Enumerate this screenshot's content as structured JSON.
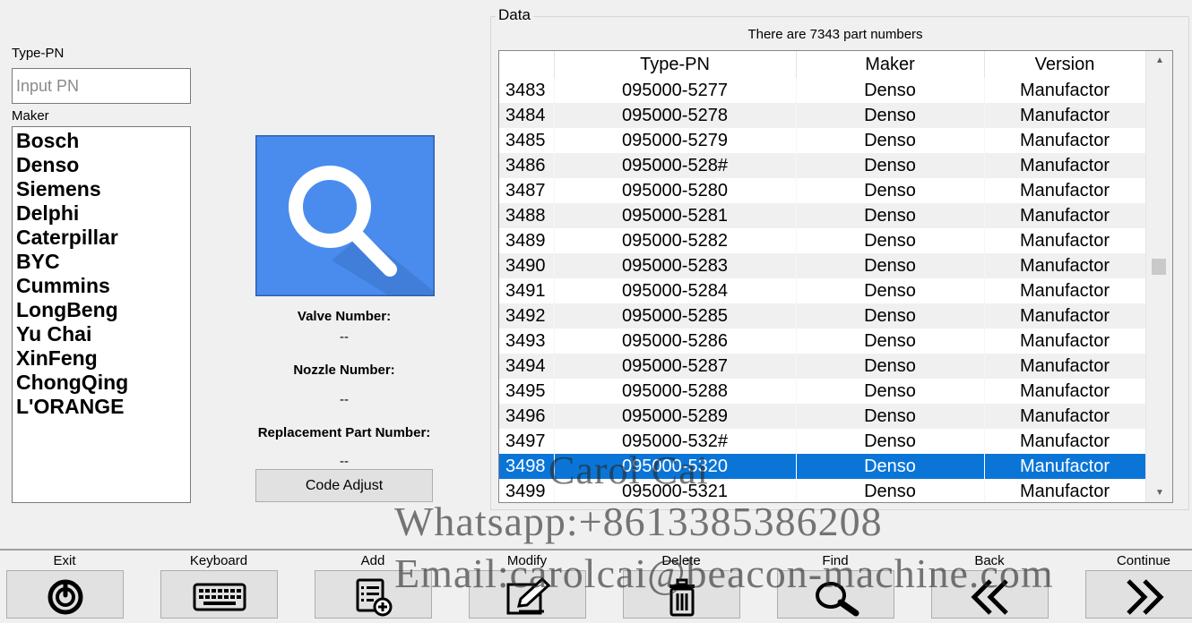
{
  "left": {
    "type_pn_label": "Type-PN",
    "input_placeholder": "Input PN",
    "maker_label": "Maker",
    "makers": [
      "Bosch",
      "Denso",
      "Siemens",
      "Delphi",
      "Caterpillar",
      "BYC",
      "Cummins",
      "LongBeng",
      "Yu Chai",
      "XinFeng",
      "ChongQing",
      "L'ORANGE"
    ]
  },
  "middle": {
    "search_icon": "magnifier-icon",
    "valve_label": "Valve Number:",
    "valve_value": "--",
    "nozzle_label": "Nozzle Number:",
    "nozzle_value": "--",
    "replacement_label": "Replacement Part Number:",
    "replacement_value": "--",
    "code_adjust_label": "Code Adjust"
  },
  "data_panel": {
    "title": "Data",
    "count_text": "There are 7343 part numbers",
    "columns": [
      "",
      "Type-PN",
      "Maker",
      "Version"
    ],
    "selected_row": "3498",
    "rows": [
      [
        "3483",
        "095000-5277",
        "Denso",
        "Manufactor"
      ],
      [
        "3484",
        "095000-5278",
        "Denso",
        "Manufactor"
      ],
      [
        "3485",
        "095000-5279",
        "Denso",
        "Manufactor"
      ],
      [
        "3486",
        "095000-528#",
        "Denso",
        "Manufactor"
      ],
      [
        "3487",
        "095000-5280",
        "Denso",
        "Manufactor"
      ],
      [
        "3488",
        "095000-5281",
        "Denso",
        "Manufactor"
      ],
      [
        "3489",
        "095000-5282",
        "Denso",
        "Manufactor"
      ],
      [
        "3490",
        "095000-5283",
        "Denso",
        "Manufactor"
      ],
      [
        "3491",
        "095000-5284",
        "Denso",
        "Manufactor"
      ],
      [
        "3492",
        "095000-5285",
        "Denso",
        "Manufactor"
      ],
      [
        "3493",
        "095000-5286",
        "Denso",
        "Manufactor"
      ],
      [
        "3494",
        "095000-5287",
        "Denso",
        "Manufactor"
      ],
      [
        "3495",
        "095000-5288",
        "Denso",
        "Manufactor"
      ],
      [
        "3496",
        "095000-5289",
        "Denso",
        "Manufactor"
      ],
      [
        "3497",
        "095000-532#",
        "Denso",
        "Manufactor"
      ],
      [
        "3498",
        "095000-5320",
        "Denso",
        "Manufactor"
      ],
      [
        "3499",
        "095000-5321",
        "Denso",
        "Manufactor"
      ]
    ]
  },
  "footer": {
    "keys": [
      {
        "key": "F1",
        "label": "Exit",
        "icon": "power-icon"
      },
      {
        "key": "F2",
        "label": "Keyboard",
        "icon": "keyboard-icon"
      },
      {
        "key": "F3",
        "label": "Add",
        "icon": "add-list-icon"
      },
      {
        "key": "F4",
        "label": "Modify",
        "icon": "edit-icon"
      },
      {
        "key": "F5",
        "label": "Delete",
        "icon": "trash-icon"
      },
      {
        "key": "F6",
        "label": "Find",
        "icon": "find-icon"
      },
      {
        "key": "F7",
        "label": "Back",
        "icon": "double-left-icon"
      },
      {
        "key": "F8",
        "label": "Continue",
        "icon": "double-right-icon"
      }
    ]
  },
  "watermark": {
    "name": "Carol Cai",
    "whatsapp": "Whatsapp:+8613385386208",
    "email": "Email:carolcai@beacon-machine.com"
  },
  "colors": {
    "selection": "#0a75d7",
    "tile_blue": "#4a8ced",
    "window_bg": "#f0f0f0"
  }
}
